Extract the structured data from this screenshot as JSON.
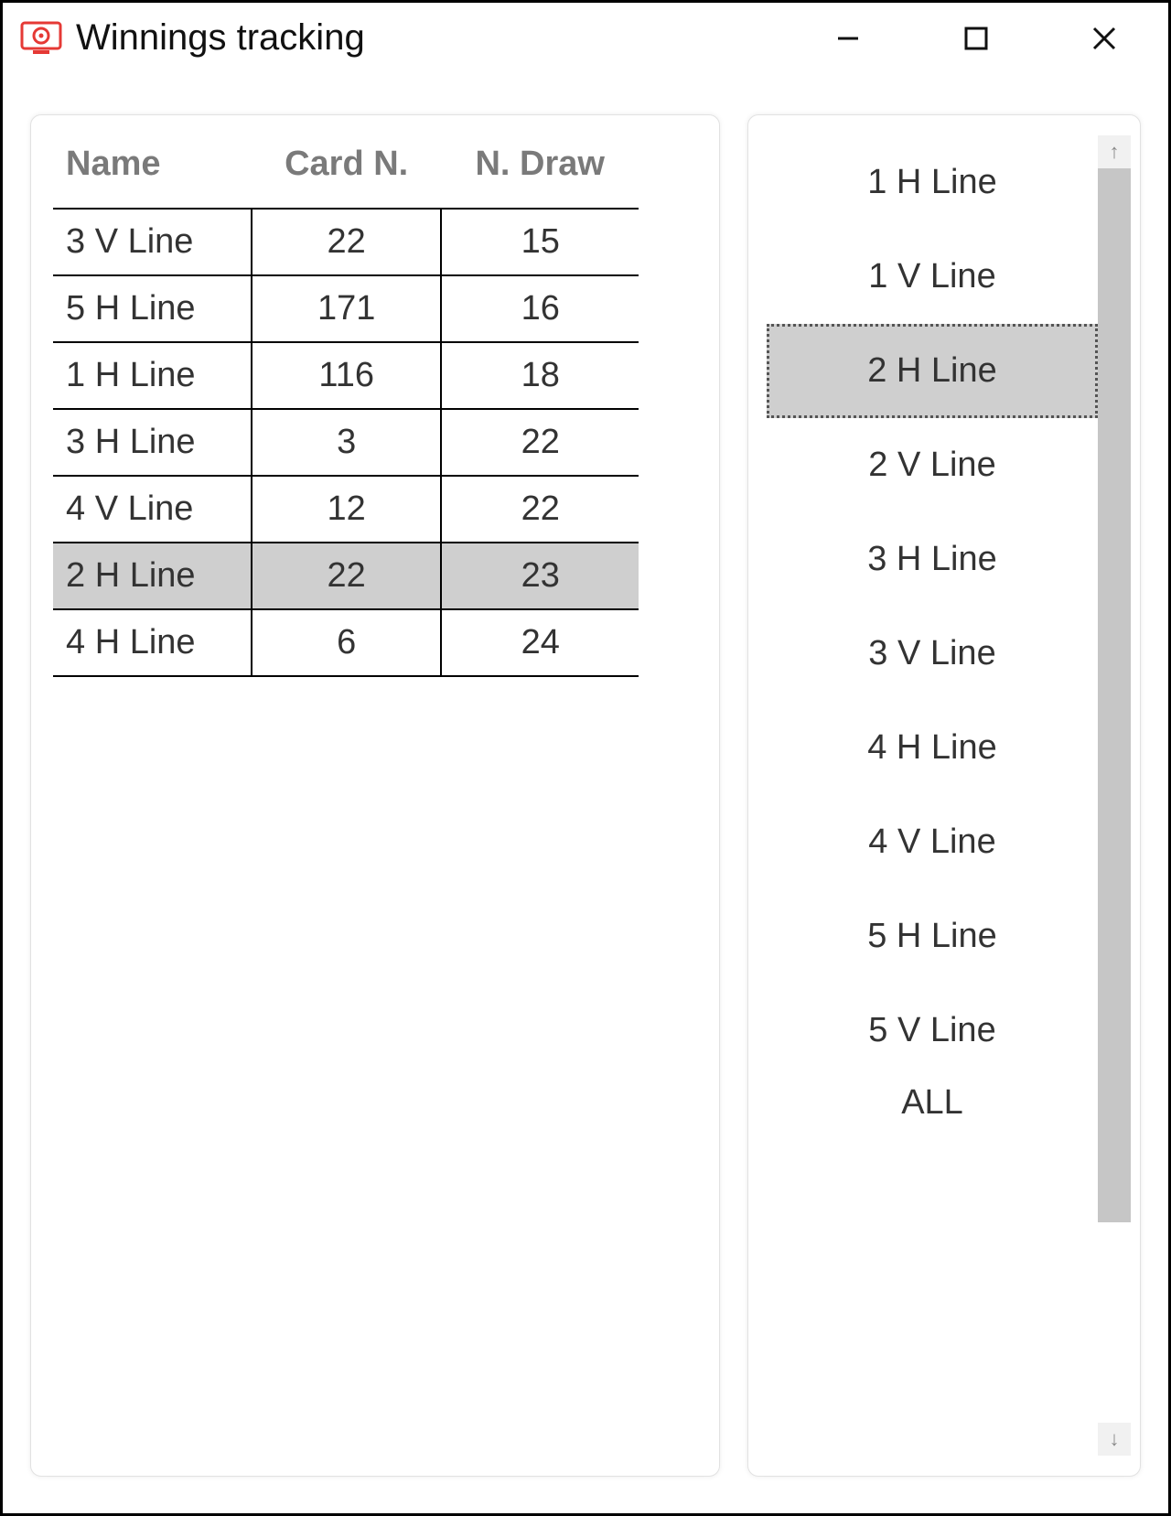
{
  "window": {
    "title": "Winnings tracking"
  },
  "table": {
    "headers": {
      "name": "Name",
      "card_n": "Card N.",
      "n_draw": "N. Draw"
    },
    "rows": [
      {
        "name": "3 V Line",
        "card_n": "22",
        "n_draw": "15",
        "selected": false
      },
      {
        "name": "5 H Line",
        "card_n": "171",
        "n_draw": "16",
        "selected": false
      },
      {
        "name": "1 H Line",
        "card_n": "116",
        "n_draw": "18",
        "selected": false
      },
      {
        "name": "3 H Line",
        "card_n": "3",
        "n_draw": "22",
        "selected": false
      },
      {
        "name": "4 V Line",
        "card_n": "12",
        "n_draw": "22",
        "selected": false
      },
      {
        "name": "2 H Line",
        "card_n": "22",
        "n_draw": "23",
        "selected": true
      },
      {
        "name": "4 H Line",
        "card_n": "6",
        "n_draw": "24",
        "selected": false
      }
    ]
  },
  "list": {
    "items": [
      {
        "label": "1 H Line",
        "selected": false
      },
      {
        "label": "1 V Line",
        "selected": false
      },
      {
        "label": "2 H Line",
        "selected": true
      },
      {
        "label": "2 V Line",
        "selected": false
      },
      {
        "label": "3 H Line",
        "selected": false
      },
      {
        "label": "3 V Line",
        "selected": false
      },
      {
        "label": "4 H Line",
        "selected": false
      },
      {
        "label": "4 V Line",
        "selected": false
      },
      {
        "label": "5 H Line",
        "selected": false
      },
      {
        "label": "5 V Line",
        "selected": false
      },
      {
        "label": "ALL",
        "selected": false,
        "clipped": true
      }
    ]
  }
}
